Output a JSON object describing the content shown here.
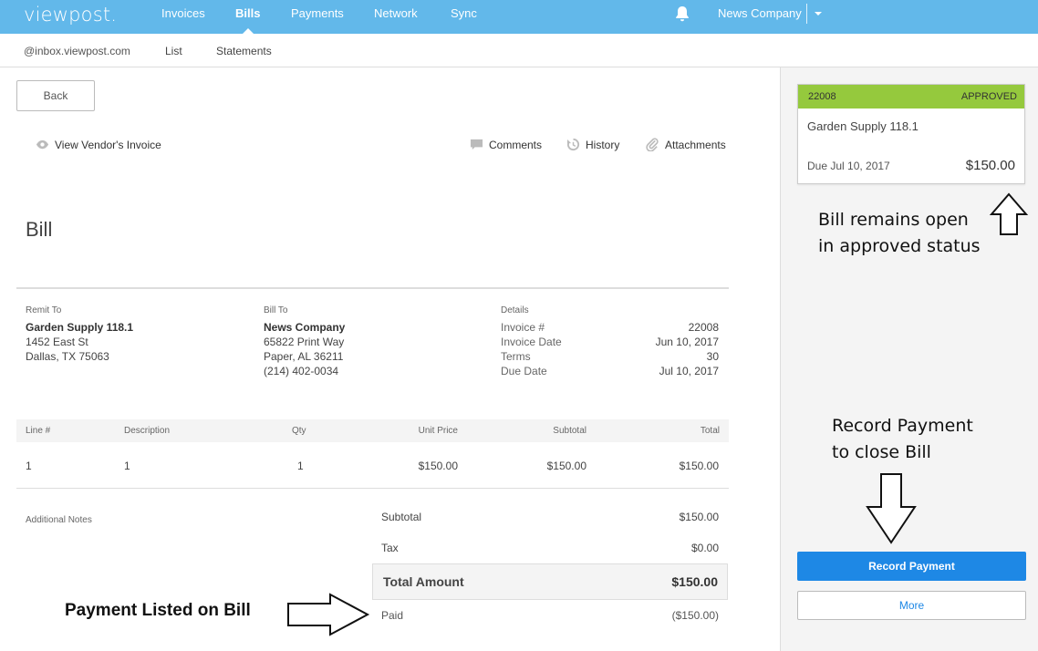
{
  "brand": {
    "logo": "viewpost."
  },
  "topnav": {
    "items": [
      {
        "label": "Invoices",
        "active": false
      },
      {
        "label": "Bills",
        "active": true
      },
      {
        "label": "Payments",
        "active": false
      },
      {
        "label": "Network",
        "active": false
      },
      {
        "label": "Sync",
        "active": false
      }
    ],
    "company": "News Company"
  },
  "subnav": {
    "email": "@inbox.viewpost.com",
    "items": [
      "List",
      "Statements"
    ]
  },
  "toolbar": {
    "back_label": "Back",
    "view_invoice": "View Vendor's Invoice",
    "comments": "Comments",
    "history": "History",
    "attachments": "Attachments"
  },
  "bill": {
    "title": "Bill",
    "remit_to": {
      "label": "Remit To",
      "name": "Garden Supply 118.1",
      "line1": "1452 East St",
      "line2": "Dallas, TX 75063"
    },
    "bill_to": {
      "label": "Bill To",
      "name": "News Company",
      "line1": "65822 Print Way",
      "line2": "Paper, AL 36211",
      "phone": "(214) 402-0034"
    },
    "details": {
      "label": "Details",
      "rows": [
        {
          "k": "Invoice #",
          "v": "22008"
        },
        {
          "k": "Invoice Date",
          "v": "Jun 10, 2017"
        },
        {
          "k": "Terms",
          "v": "30"
        },
        {
          "k": "Due Date",
          "v": "Jul 10, 2017"
        }
      ]
    },
    "table": {
      "headers": [
        "Line #",
        "Description",
        "Qty",
        "Unit Price",
        "Subtotal",
        "Total"
      ],
      "rows": [
        [
          "1",
          "1",
          "1",
          "$150.00",
          "$150.00",
          "$150.00"
        ]
      ]
    },
    "notes_label": "Additional Notes",
    "totals": {
      "subtotal_label": "Subtotal",
      "subtotal": "$150.00",
      "tax_label": "Tax",
      "tax": "$0.00",
      "total_label": "Total Amount",
      "total": "$150.00",
      "paid_label": "Paid",
      "paid": "($150.00)"
    }
  },
  "card": {
    "number": "22008",
    "status": "APPROVED",
    "name": "Garden Supply 118.1",
    "due": "Due Jul 10, 2017",
    "amount": "$150.00",
    "status_color": "#95c93d"
  },
  "actions": {
    "record_payment": "Record Payment",
    "more": "More"
  },
  "annotations": {
    "open_l1": "Bill remains open",
    "open_l2": "in approved status",
    "record_l1": "Record Payment",
    "record_l2": "to close Bill",
    "payment_listed": "Payment Listed on Bill"
  },
  "colors": {
    "nav": "#62b8ea",
    "primary": "#1e88e5",
    "approved": "#95c93d"
  }
}
